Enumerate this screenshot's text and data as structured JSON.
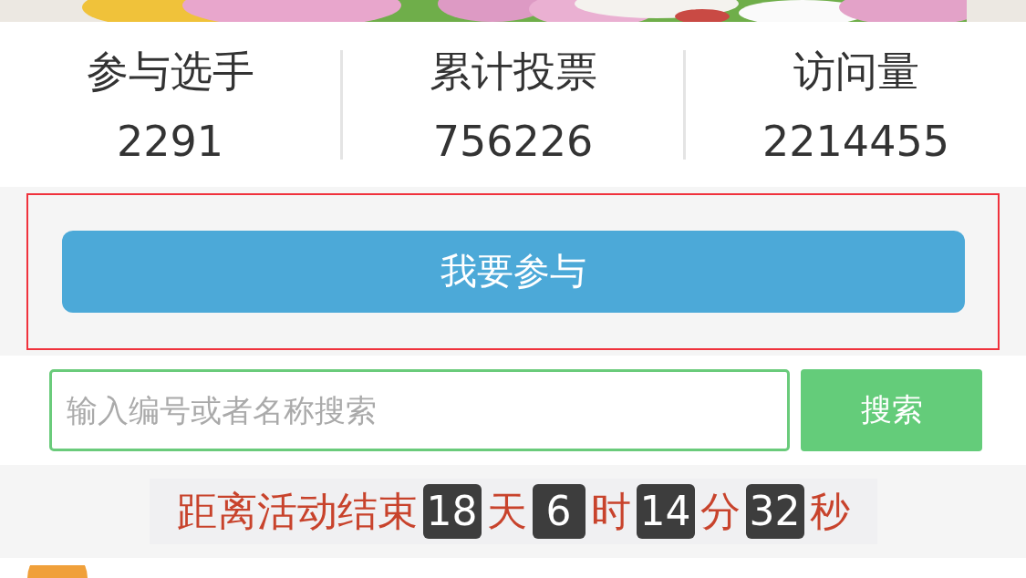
{
  "stats": [
    {
      "label": "参与选手",
      "value": "2291"
    },
    {
      "label": "累计投票",
      "value": "756226"
    },
    {
      "label": "访问量",
      "value": "2214455"
    }
  ],
  "join_button": "我要参与",
  "search": {
    "placeholder": "输入编号或者名称搜索",
    "button": "搜索"
  },
  "countdown": {
    "label": "距离活动结束",
    "parts": [
      {
        "value": "18",
        "unit": "天"
      },
      {
        "value": "6",
        "unit": "时"
      },
      {
        "value": "14",
        "unit": "分"
      },
      {
        "value": "32",
        "unit": "秒"
      }
    ]
  }
}
